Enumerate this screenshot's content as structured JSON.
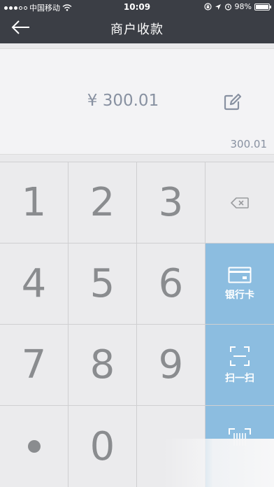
{
  "status_bar": {
    "carrier": "中国移动",
    "time": "10:09",
    "battery": "98%",
    "battery_level": 0.98
  },
  "header": {
    "title": "商户收款"
  },
  "amount": {
    "display": "¥ 300.01",
    "summary": "300.01"
  },
  "keypad": {
    "keys": [
      "1",
      "2",
      "3",
      "4",
      "5",
      "6",
      "7",
      "8",
      "9",
      "0"
    ],
    "side_buttons": {
      "bank_card": "银行卡",
      "scan": "扫一扫"
    }
  },
  "colors": {
    "header_bg": "#3b3e45",
    "accent_blue": "#8cbde0",
    "text_gray": "#8891a1"
  }
}
